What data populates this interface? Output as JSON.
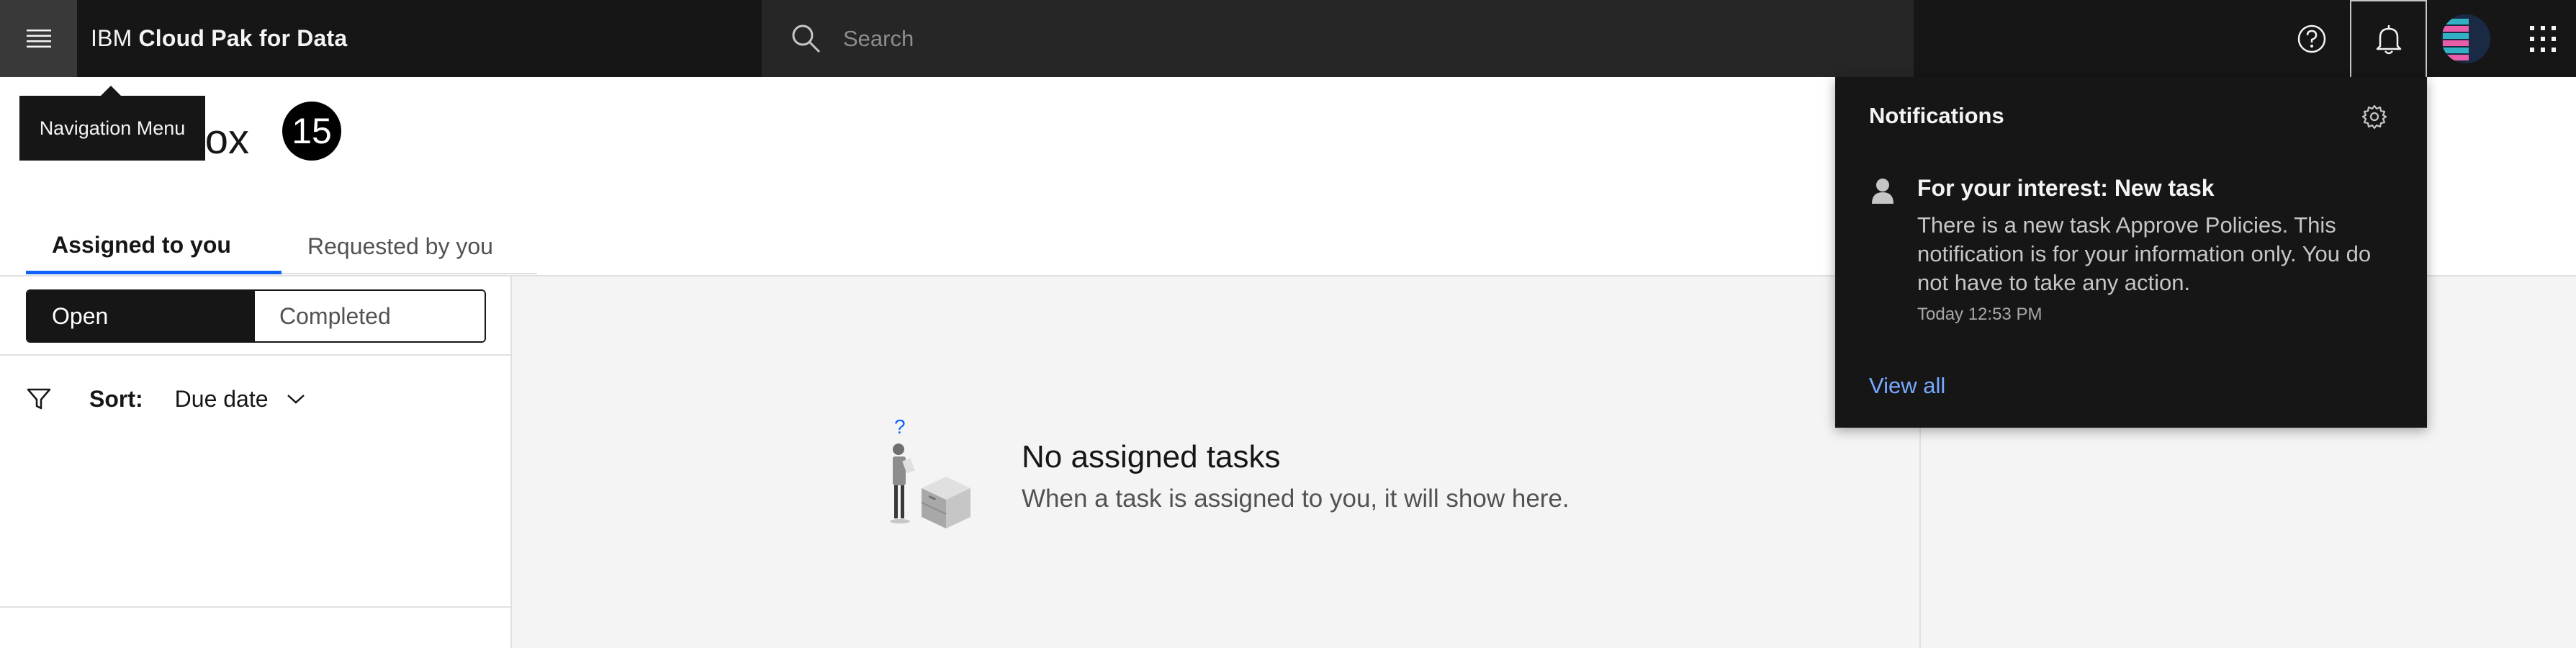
{
  "header": {
    "brand_prefix": "IBM",
    "brand_name": "Cloud Pak for Data",
    "search_placeholder": "Search",
    "icons": {
      "menu": "hamburger-menu-icon",
      "search": "search-icon",
      "help": "help-icon",
      "notifications": "bell-icon",
      "apps": "app-switcher-icon"
    }
  },
  "tooltip": {
    "text": "Navigation Menu"
  },
  "page": {
    "title": "Task inbox",
    "count": "15"
  },
  "tabs": [
    {
      "label": "Assigned to you",
      "active": true
    },
    {
      "label": "Requested by you",
      "active": false
    }
  ],
  "filter": {
    "toggle": {
      "open": "Open",
      "completed": "Completed"
    },
    "sort_label": "Sort:",
    "sort_value": "Due date"
  },
  "empty_state": {
    "title": "No assigned tasks",
    "subtitle": "When a task is assigned to you, it will show here."
  },
  "notifications": {
    "title": "Notifications",
    "items": [
      {
        "title": "For your interest: New task",
        "body": "There is a new task Approve Policies. This notification is for your information only. You do not have to take any action.",
        "time": "Today 12:53 PM"
      }
    ],
    "view_all": "View all"
  },
  "colors": {
    "header_bg": "#161616",
    "search_bg": "#262626",
    "accent": "#0f62fe",
    "link": "#78a9ff",
    "panel_bg": "#f4f4f4"
  }
}
